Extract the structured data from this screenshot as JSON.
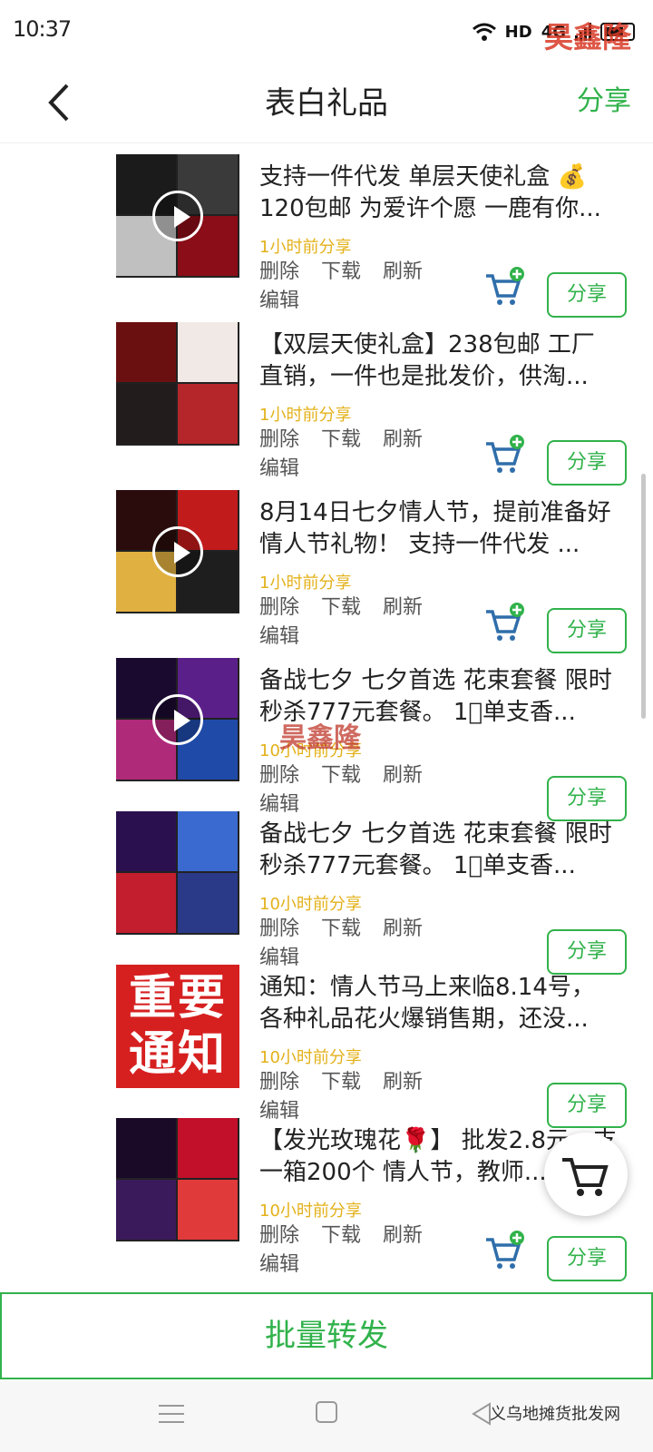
{
  "status_bar": {
    "time": "10:37",
    "network_label": "HD",
    "network_type": "4G",
    "watermark": "昊鑫隆"
  },
  "header": {
    "title": "表白礼品",
    "share_label": "分享"
  },
  "actions": {
    "delete": "删除",
    "download": "下载",
    "refresh": "刷新",
    "edit": "编辑",
    "share": "分享"
  },
  "items": [
    {
      "desc": "支持一件代发 单层天使礼盒 💰120包邮 为爱许个愿 一鹿有你...",
      "time": "1小时前分享",
      "thumb": "video",
      "has_cart": true
    },
    {
      "desc": "【双层天使礼盒】238包邮 工厂直销，一件也是批发价，供淘...",
      "time": "1小时前分享",
      "thumb": "grid",
      "has_cart": true
    },
    {
      "desc": "8月14日七夕情人节，提前准备好情人节礼物！ 支持一件代发 ...",
      "time": "1小时前分享",
      "thumb": "video",
      "has_cart": true
    },
    {
      "desc": "备战七夕 七夕首选 花束套餐 限时秒杀777元套餐。 1⃣单支香...",
      "time": "10小时前分享",
      "thumb": "video",
      "has_cart": false
    },
    {
      "desc": "备战七夕 七夕首选 花束套餐 限时秒杀777元套餐。 1⃣单支香...",
      "time": "10小时前分享",
      "thumb": "grid",
      "has_cart": false
    },
    {
      "desc": "通知：情人节马上来临8.14号，各种礼品花火爆销售期，还没...",
      "time": "10小时前分享",
      "thumb": "notice",
      "has_cart": false
    },
    {
      "desc": "【发光玫瑰花🌹】 批发2.8元一支 一箱200个 情人节，教师...",
      "time": "10小时前分享",
      "thumb": "grid",
      "has_cart": true
    }
  ],
  "notice_thumb_text": "重要通知",
  "mid_watermark": "昊鑫隆",
  "batch_button": "批量转发",
  "footer_watermark": "义乌地摊货批发网",
  "colors": {
    "accent": "#31b24b",
    "time": "#e3b11a",
    "cart": "#2f6eaa"
  }
}
